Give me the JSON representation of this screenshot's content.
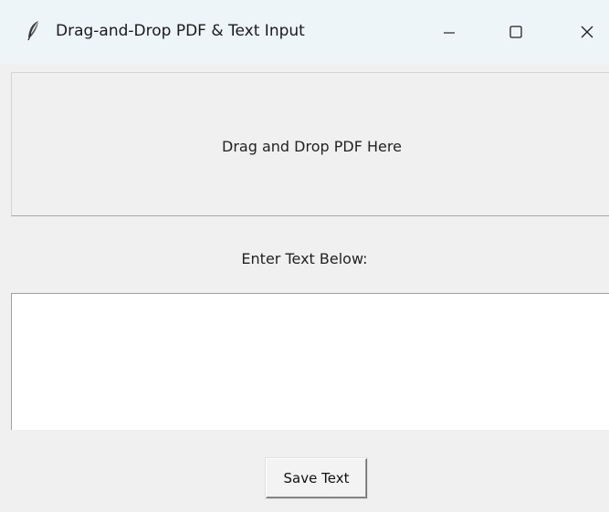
{
  "window": {
    "title": "Drag-and-Drop PDF & Text Input",
    "controls": {
      "minimize": "minimize-icon",
      "maximize": "maximize-icon",
      "close": "close-icon"
    }
  },
  "drop_zone": {
    "label": "Drag and Drop PDF Here"
  },
  "text_input": {
    "label": "Enter Text Below:",
    "value": ""
  },
  "actions": {
    "save_label": "Save Text"
  },
  "colors": {
    "titlebar": "#eef5f9",
    "window_bg": "#f0f0f0",
    "text_area_bg": "#ffffff"
  }
}
